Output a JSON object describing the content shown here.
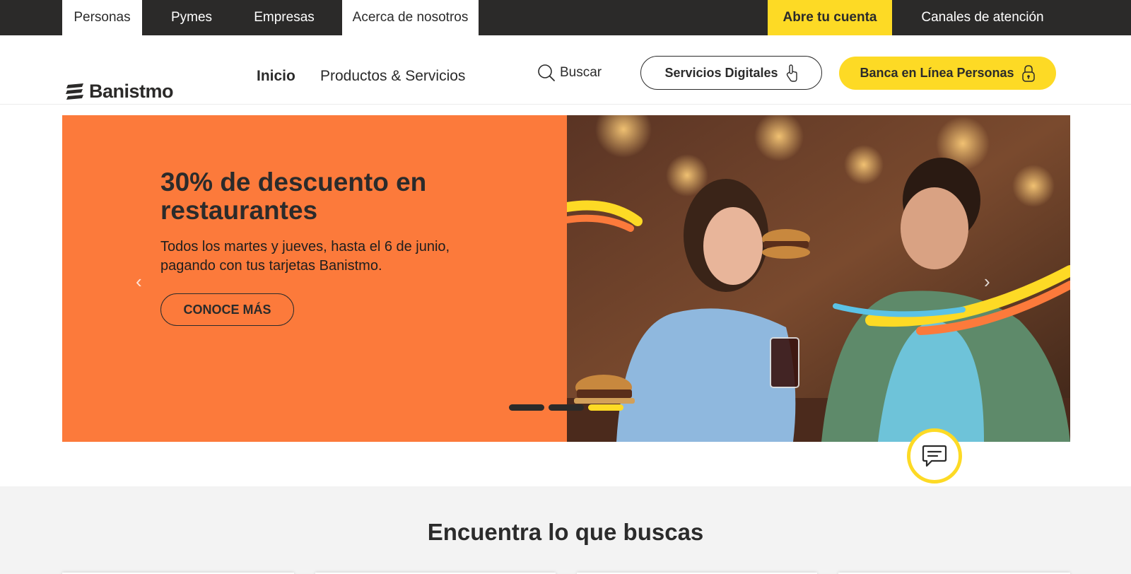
{
  "topbar": {
    "tabs": [
      {
        "label": "Personas"
      },
      {
        "label": "Pymes"
      },
      {
        "label": "Empresas"
      },
      {
        "label": "Acerca de nosotros"
      }
    ],
    "open_account": "Abre tu cuenta",
    "channels": "Canales de atención"
  },
  "header": {
    "logo_text": "Banistmo",
    "nav": [
      {
        "label": "Inicio"
      },
      {
        "label": "Productos & Servicios"
      }
    ],
    "search_label": "Buscar",
    "digital_services": "Servicios Digitales",
    "online_banking": "Banca en Línea Personas"
  },
  "hero": {
    "title": "30% de descuento en restaurantes",
    "text": "Todos los martes y jueves, hasta el 6 de junio, pagando con tus tarjetas Banistmo.",
    "cta": "CONOCE MÁS",
    "prev": "‹",
    "next": "›",
    "slide_count": 3,
    "active_slide": 3
  },
  "find": {
    "title": "Encuentra lo que buscas"
  },
  "colors": {
    "brand_yellow": "#fdda25",
    "brand_dark": "#2b2a29",
    "hero_orange": "#fc7a3b",
    "section_gray": "#f3f3f3"
  },
  "icons": [
    "search-icon",
    "hand-pointer-icon",
    "lock-icon",
    "chat-icon",
    "logo-icon"
  ]
}
